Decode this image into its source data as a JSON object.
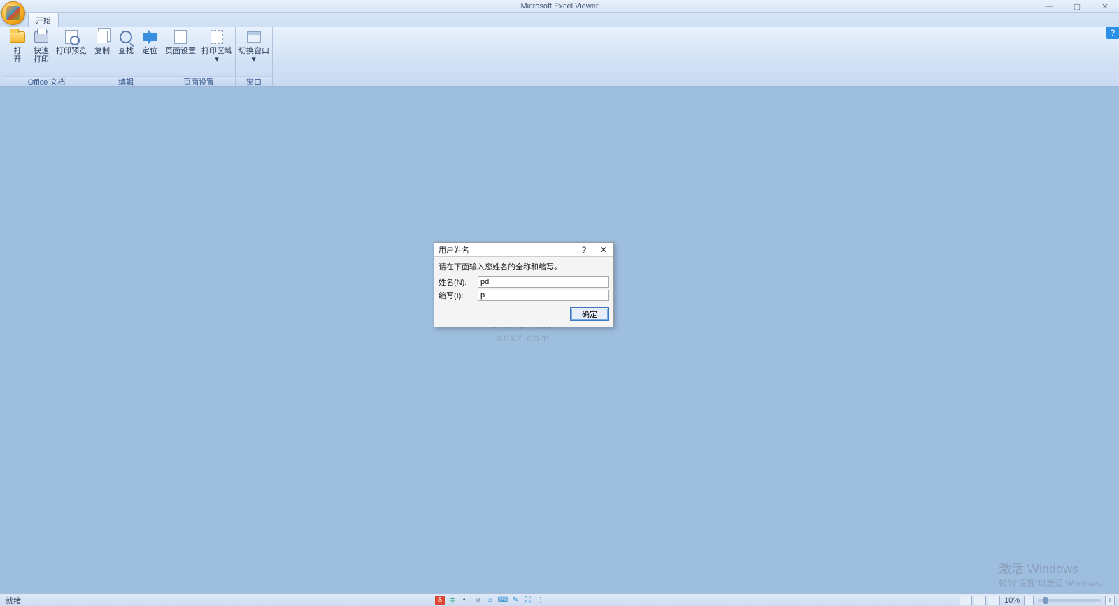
{
  "app": {
    "title": "Microsoft Excel Viewer"
  },
  "window_controls": {
    "minimize": "—",
    "maximize": "▢",
    "close": "✕"
  },
  "tabs": {
    "home": "开始"
  },
  "ribbon": {
    "groups": {
      "office_doc": {
        "label": "Office 文档",
        "open": "打\n开",
        "quick_print": "快速\n打印",
        "print_preview": "打印预览"
      },
      "edit": {
        "label": "编辑",
        "copy": "复制",
        "find": "查找",
        "goto": "定位"
      },
      "page_setup": {
        "label": "页面设置",
        "page_setup_btn": "页面设置",
        "print_area": "打印区域\n▾"
      },
      "window": {
        "label": "窗口",
        "switch_window": "切换窗口\n▾"
      }
    }
  },
  "help_badge": "?",
  "dialog": {
    "title": "用户姓名",
    "prompt": "请在下面输入您姓名的全称和缩写。",
    "name_label": "姓名(N):",
    "name_value": "pd",
    "initials_label": "缩写(I):",
    "initials_value": "p",
    "ok": "确定",
    "help": "?",
    "close": "✕"
  },
  "statusbar": {
    "ready": "就绪",
    "zoom_pct": "10%",
    "ime": {
      "s": "S",
      "zh": "中",
      "dot": "•.",
      "smile": "☺",
      "mic": "⌂",
      "kb": "⌨",
      "a": "✎",
      "cloth": "⛶",
      "menu": "⋮"
    }
  },
  "watermark": {
    "brand_cn": "安下载",
    "brand_en": "anxz.com"
  },
  "activate": {
    "l1": "激活 Windows",
    "l2": "转到“设置”以激活 Windows。"
  }
}
